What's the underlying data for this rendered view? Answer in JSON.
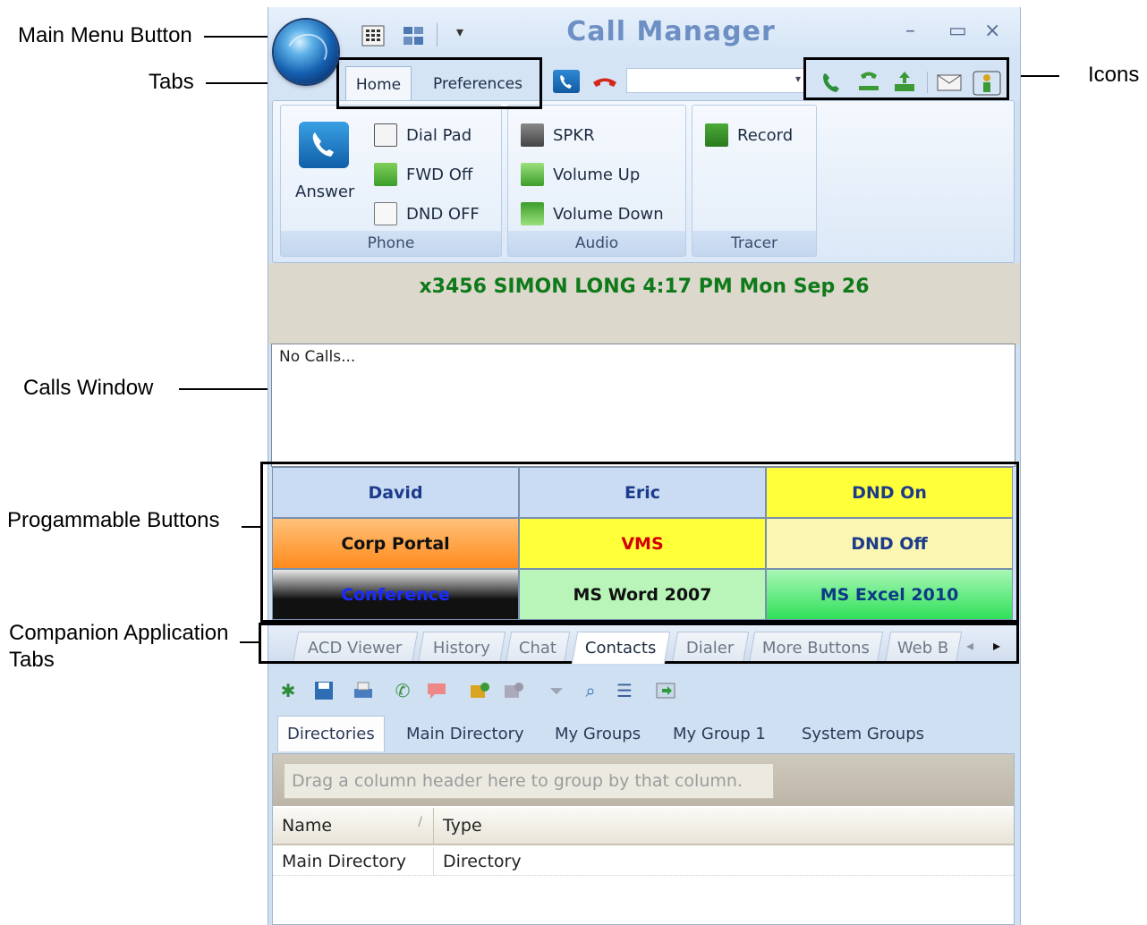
{
  "callouts": {
    "main_menu": "Main Menu Button",
    "tabs": "Tabs",
    "icons": "Icons",
    "calls_window": "Calls Window",
    "programmable": "Progammable Buttons",
    "companion_line1": "Companion Application",
    "companion_line2": "Tabs"
  },
  "window": {
    "title": "Call Manager",
    "min": "–",
    "max": "▭",
    "close": "×",
    "qat_dropdown": "▾"
  },
  "ribbon_tabs": [
    "Home",
    "Preferences"
  ],
  "combo": {
    "value": "",
    "arrow": "▾"
  },
  "groups": {
    "phone": {
      "label": "Phone",
      "answer": "Answer",
      "dial_pad": "Dial Pad",
      "fwd": "FWD Off",
      "dnd": "DND OFF"
    },
    "audio": {
      "label": "Audio",
      "spkr": "SPKR",
      "vol_up": "Volume Up",
      "vol_down": "Volume Down"
    },
    "tracer": {
      "label": "Tracer",
      "record": "Record"
    }
  },
  "status": "x3456 SIMON LONG  4:17 PM Mon Sep 26",
  "calls": {
    "empty_text": "No Calls..."
  },
  "prog_buttons": [
    {
      "label": "David",
      "color": "#1d3b8c",
      "bg": "#c9dcf3"
    },
    {
      "label": "Eric",
      "color": "#1d3b8c",
      "bg": "#c9dcf3"
    },
    {
      "label": "DND On",
      "color": "#1d3b8c",
      "bg": "#ffff3a"
    },
    {
      "label": "Corp Portal",
      "color": "#111111",
      "bg": "#ff8a1c"
    },
    {
      "label": "VMS",
      "color": "#d40000",
      "bg": "#ffff3a"
    },
    {
      "label": "DND Off",
      "color": "#1d3b8c",
      "bg": "#fbf6b2"
    },
    {
      "label": "Conference",
      "color": "#1a2bff",
      "bg": "#111111"
    },
    {
      "label": "MS Word 2007",
      "color": "#111111",
      "bg": "#b9f5b9"
    },
    {
      "label": "MS Excel 2010",
      "color": "#0d3a86",
      "bg": "#2fe05a"
    }
  ],
  "companion_tabs": [
    "ACD Viewer",
    "History",
    "Chat",
    "Contacts",
    "Dialer",
    "More Buttons",
    "Web B"
  ],
  "companion_scroll": {
    "left": "◂",
    "right": "▸"
  },
  "sub_tabs": [
    "Directories",
    "Main Directory",
    "My Groups",
    "My Group 1",
    "System Groups"
  ],
  "grid": {
    "group_hint": "Drag a column header here to group by that column.",
    "columns": [
      "Name",
      "Type"
    ],
    "sort_glyph": "/",
    "rows": [
      {
        "name": "Main Directory",
        "type": "Directory"
      }
    ]
  },
  "colors": {
    "status_text": "#0f7a1a",
    "title_text": "#6d8fc4"
  }
}
